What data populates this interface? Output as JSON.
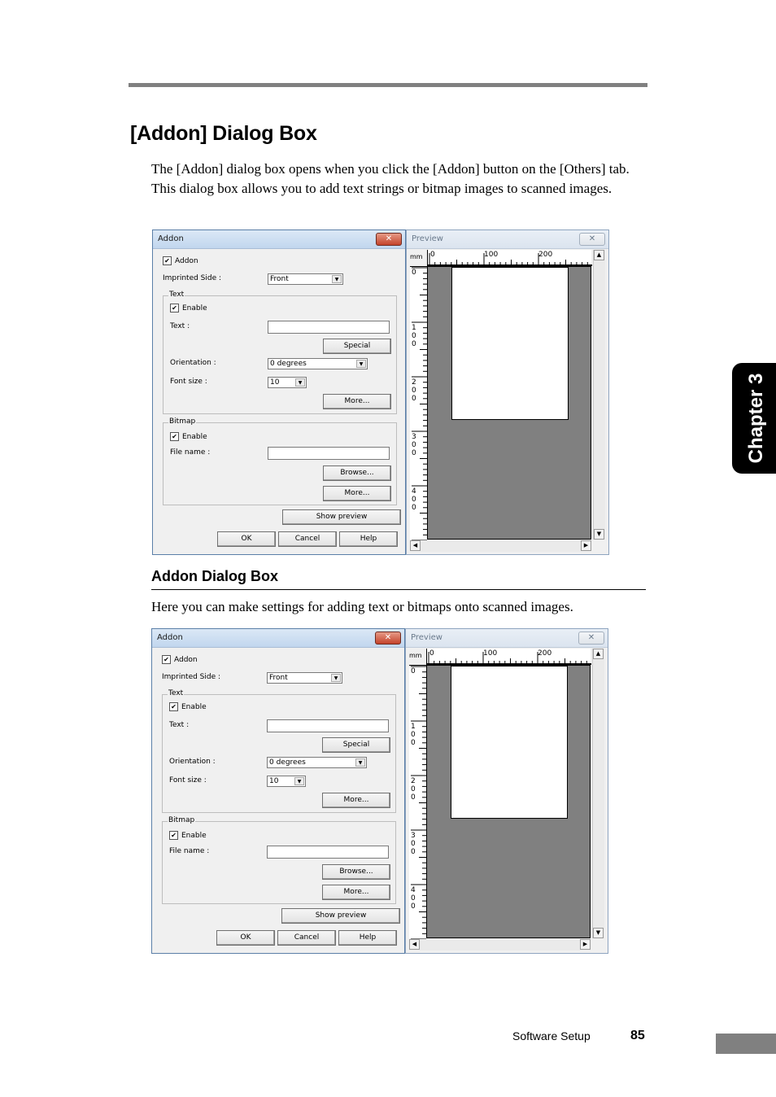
{
  "page": {
    "title": "[Addon] Dialog Box",
    "intro": "The [Addon] dialog box opens when you click the [Addon] button on the [Others] tab. This dialog box allows you to add text strings or bitmap images to scanned images.",
    "subheading": "Addon Dialog Box",
    "subtext": "Here you can make settings for adding text or bitmaps onto scanned images.",
    "chapter_tab": "Chapter 3",
    "footer_section": "Software Setup",
    "footer_page": "85"
  },
  "dialog": {
    "title": "Addon",
    "close_icon": "✕",
    "addon_checkbox": {
      "label": "Addon",
      "checked": true,
      "mark": "✔"
    },
    "imprinted_side": {
      "label": "Imprinted Side :",
      "value": "Front"
    },
    "text_group": {
      "legend": "Text",
      "enable": {
        "label": "Enable",
        "checked": true,
        "mark": "✔"
      },
      "text_label": "Text :",
      "text_value": "",
      "special_button": "Special",
      "orientation": {
        "label": "Orientation :",
        "value": "0 degrees"
      },
      "font_size": {
        "label": "Font size :",
        "value": "10"
      },
      "more_button": "More..."
    },
    "bitmap_group": {
      "legend": "Bitmap",
      "enable": {
        "label": "Enable",
        "checked": true,
        "mark": "✔"
      },
      "file_label": "File name :",
      "file_value": "",
      "browse_button": "Browse...",
      "more_button": "More..."
    },
    "show_preview_button": "Show preview",
    "ok_button": "OK",
    "cancel_button": "Cancel",
    "help_button": "Help",
    "dropdown_arrow": "▼"
  },
  "preview": {
    "title": "Preview",
    "close_icon": "✕",
    "unit": "mm",
    "h_ruler_labels": [
      "0",
      "100",
      "200"
    ],
    "v_ruler_labels": [
      "0",
      "1\n0\n0",
      "2\n0\n0",
      "3\n0\n0",
      "4\n0\n0"
    ],
    "scroll_up": "▲",
    "scroll_down": "▼",
    "scroll_left": "◀",
    "scroll_right": "▶"
  }
}
